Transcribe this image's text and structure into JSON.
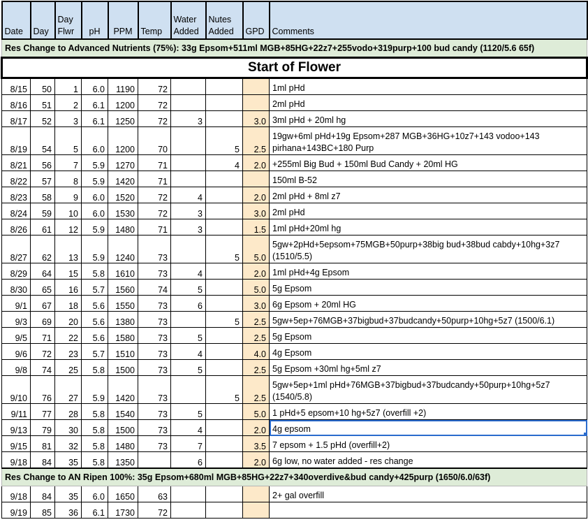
{
  "headers": {
    "date": "Date",
    "day": "Day",
    "day_flwr": [
      "Day",
      "Flwr"
    ],
    "ph": "pH",
    "ppm": "PPM",
    "temp": "Temp",
    "water_added": [
      "Water",
      "Added"
    ],
    "nutes_added": [
      "Nutes",
      "Added"
    ],
    "gpd": "GPD",
    "comments": "Comments"
  },
  "res_change_1": "Res Change to Advanced Nutrients (75%): 33g Epsom+511ml MGB+85HG+22z7+255vodo+319purp+100  bud candy (1120/5.6 65f)",
  "banner": "Start of Flower",
  "rows_a": [
    {
      "date": "8/15",
      "day": "50",
      "flwr": "1",
      "ph": "6.0",
      "ppm": "1190",
      "temp": "72",
      "water": "",
      "nutes": "",
      "gpd": "",
      "comment": "1ml pHd"
    },
    {
      "date": "8/16",
      "day": "51",
      "flwr": "2",
      "ph": "6.1",
      "ppm": "1200",
      "temp": "72",
      "water": "",
      "nutes": "",
      "gpd": "",
      "comment": "2ml pHd"
    },
    {
      "date": "8/17",
      "day": "52",
      "flwr": "3",
      "ph": "6.1",
      "ppm": "1250",
      "temp": "72",
      "water": "3",
      "nutes": "",
      "gpd": "3.0",
      "comment": "3ml pHd + 20ml hg"
    },
    {
      "date": "8/19",
      "day": "54",
      "flwr": "5",
      "ph": "6.0",
      "ppm": "1200",
      "temp": "70",
      "water": "",
      "nutes": "5",
      "gpd": "2.5",
      "comment": "19gw+6ml pHd+19g Epsom+287 MGB+36HG+10z7+143 vodoo+143 pirhana+143BC+180 Purp",
      "tall": true
    },
    {
      "date": "8/21",
      "day": "56",
      "flwr": "7",
      "ph": "5.9",
      "ppm": "1270",
      "temp": "71",
      "water": "",
      "nutes": "4",
      "gpd": "2.0",
      "comment": "+255ml Big Bud + 150ml Bud Candy + 20ml HG"
    },
    {
      "date": "8/22",
      "day": "57",
      "flwr": "8",
      "ph": "5.9",
      "ppm": "1420",
      "temp": "71",
      "water": "",
      "nutes": "",
      "gpd": "",
      "comment": "150ml B-52"
    },
    {
      "date": "8/23",
      "day": "58",
      "flwr": "9",
      "ph": "6.0",
      "ppm": "1520",
      "temp": "72",
      "water": "4",
      "nutes": "",
      "gpd": "2.0",
      "comment": "2ml pHd + 8ml z7"
    },
    {
      "date": "8/24",
      "day": "59",
      "flwr": "10",
      "ph": "6.0",
      "ppm": "1530",
      "temp": "72",
      "water": "3",
      "nutes": "",
      "gpd": "3.0",
      "comment": "2ml pHd"
    },
    {
      "date": "8/26",
      "day": "61",
      "flwr": "12",
      "ph": "5.9",
      "ppm": "1480",
      "temp": "71",
      "water": "3",
      "nutes": "",
      "gpd": "1.5",
      "comment": "1ml pHd+20ml hg"
    },
    {
      "date": "8/27",
      "day": "62",
      "flwr": "13",
      "ph": "5.9",
      "ppm": "1240",
      "temp": "73",
      "water": "",
      "nutes": "5",
      "gpd": "5.0",
      "comment": "5gw+2pHd+5epsom+75MGB+50purp+38big bud+38bud cabdy+10hg+3z7 (1510/5.5)",
      "tall": true
    },
    {
      "date": "8/29",
      "day": "64",
      "flwr": "15",
      "ph": "5.8",
      "ppm": "1610",
      "temp": "73",
      "water": "4",
      "nutes": "",
      "gpd": "2.0",
      "comment": "1ml pHd+4g Epsom"
    },
    {
      "date": "8/30",
      "day": "65",
      "flwr": "16",
      "ph": "5.7",
      "ppm": "1560",
      "temp": "74",
      "water": "5",
      "nutes": "",
      "gpd": "5.0",
      "comment": "5g Epsom"
    },
    {
      "date": "9/1",
      "day": "67",
      "flwr": "18",
      "ph": "5.6",
      "ppm": "1550",
      "temp": "73",
      "water": "6",
      "nutes": "",
      "gpd": "3.0",
      "comment": "6g Epsom + 20ml HG"
    },
    {
      "date": "9/3",
      "day": "69",
      "flwr": "20",
      "ph": "5.6",
      "ppm": "1380",
      "temp": "73",
      "water": "",
      "nutes": "5",
      "gpd": "2.5",
      "comment": "5gw+5ep+76MGB+37bigbud+37budcandy+50purp+10hg+5z7 (1500/6.1)"
    },
    {
      "date": "9/5",
      "day": "71",
      "flwr": "22",
      "ph": "5.6",
      "ppm": "1580",
      "temp": "73",
      "water": "5",
      "nutes": "",
      "gpd": "2.5",
      "comment": "5g Epsom"
    },
    {
      "date": "9/6",
      "day": "72",
      "flwr": "23",
      "ph": "5.7",
      "ppm": "1510",
      "temp": "73",
      "water": "4",
      "nutes": "",
      "gpd": "4.0",
      "comment": "4g Epsom"
    },
    {
      "date": "9/8",
      "day": "74",
      "flwr": "25",
      "ph": "5.8",
      "ppm": "1500",
      "temp": "73",
      "water": "5",
      "nutes": "",
      "gpd": "2.5",
      "comment": "5g Epsom +30ml hg+5ml z7"
    },
    {
      "date": "9/10",
      "day": "76",
      "flwr": "27",
      "ph": "5.9",
      "ppm": "1420",
      "temp": "73",
      "water": "",
      "nutes": "5",
      "gpd": "2.5",
      "comment": "5gw+5ep+1ml pHd+76MGB+37bigbud+37budcandy+50purp+10hg+5z7 (1540/5.8)",
      "tall": true
    },
    {
      "date": "9/11",
      "day": "77",
      "flwr": "28",
      "ph": "5.8",
      "ppm": "1540",
      "temp": "73",
      "water": "5",
      "nutes": "",
      "gpd": "5.0",
      "comment": "1 pHd+5 epsom+10 hg+5z7 (overfill +2)"
    },
    {
      "date": "9/13",
      "day": "79",
      "flwr": "30",
      "ph": "5.8",
      "ppm": "1500",
      "temp": "73",
      "water": "4",
      "nutes": "",
      "gpd": "2.0",
      "comment": "4g epsom",
      "selected": true
    },
    {
      "date": "9/15",
      "day": "81",
      "flwr": "32",
      "ph": "5.8",
      "ppm": "1480",
      "temp": "73",
      "water": "7",
      "nutes": "",
      "gpd": "3.5",
      "comment": "7 epsom + 1.5 pHd (overfill+2)"
    },
    {
      "date": "9/18",
      "day": "84",
      "flwr": "35",
      "ph": "5.8",
      "ppm": "1350",
      "temp": "",
      "water": "6",
      "nutes": "",
      "gpd": "2.0",
      "comment": "6g low, no water added - res change"
    }
  ],
  "res_change_2": "Res Change to AN Ripen 100%: 35g Epsom+680ml MGB+85HG+22z7+340overdive&bud candy+425purp (1650/6.0/63f)",
  "rows_b": [
    {
      "date": "9/18",
      "day": "84",
      "flwr": "35",
      "ph": "6.0",
      "ppm": "1650",
      "temp": "63",
      "water": "",
      "nutes": "",
      "gpd": "",
      "comment": "2+ gal overfill"
    },
    {
      "date": "9/19",
      "day": "85",
      "flwr": "36",
      "ph": "6.1",
      "ppm": "1730",
      "temp": "72",
      "water": "",
      "nutes": "",
      "gpd": "",
      "comment": ""
    }
  ],
  "colors": {
    "header_bg": "#cfe0f1",
    "res_change_bg": "#deecd8",
    "gpd_bg": "#fde9c9",
    "selection": "#2a6bcd"
  }
}
